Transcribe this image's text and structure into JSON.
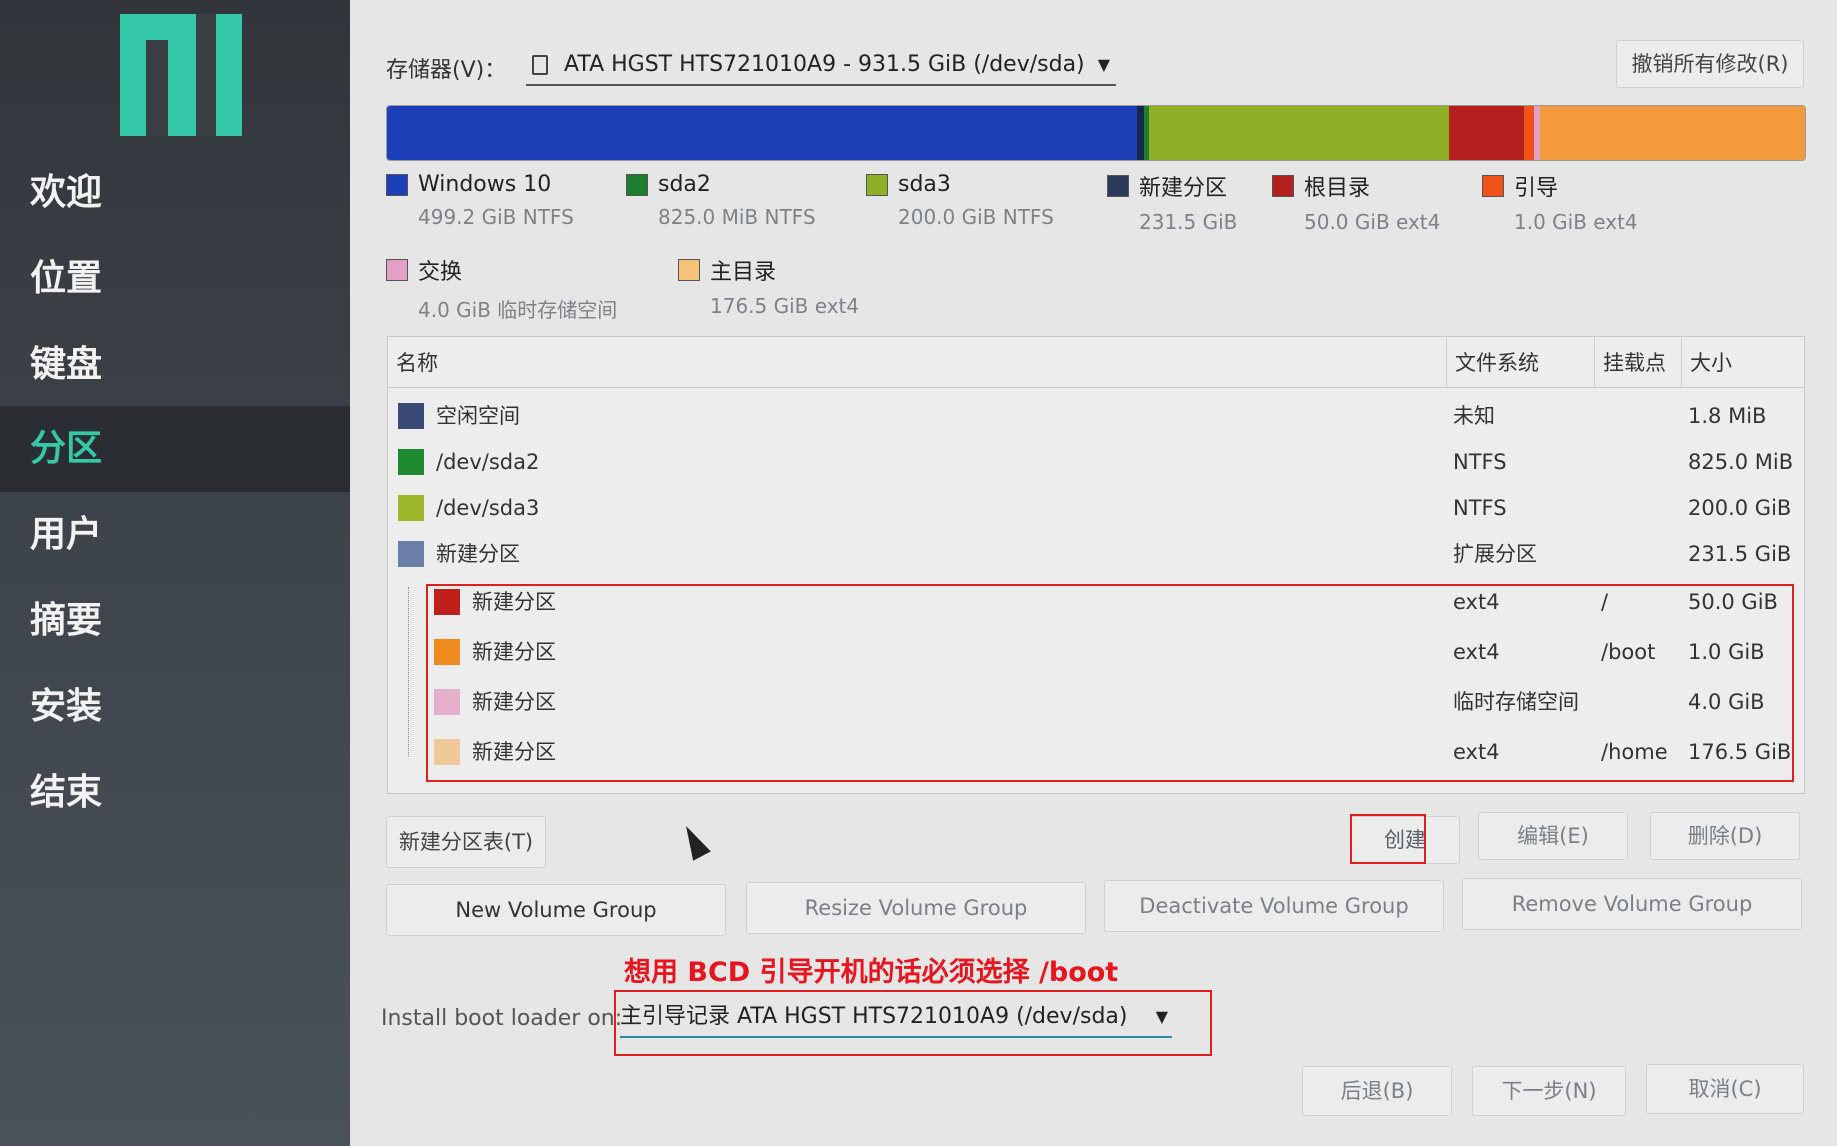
{
  "sidebar": {
    "items": [
      {
        "label": "欢迎",
        "active": false
      },
      {
        "label": "位置",
        "active": false
      },
      {
        "label": "键盘",
        "active": false
      },
      {
        "label": "分区",
        "active": true
      },
      {
        "label": "用户",
        "active": false
      },
      {
        "label": "摘要",
        "active": false
      },
      {
        "label": "安装",
        "active": false
      },
      {
        "label": "结束",
        "active": false
      }
    ]
  },
  "storage": {
    "label": "存储器(V)：",
    "selected": "ATA HGST HTS721010A9 - 931.5 GiB (/dev/sda)"
  },
  "buttons": {
    "revert_all": "撤销所有修改(R)",
    "new_partition_table": "新建分区表(T)",
    "create": "创建",
    "edit": "编辑(E)",
    "delete": "删除(D)",
    "new_vg": "New Volume Group",
    "resize_vg": "Resize Volume Group",
    "deactivate_vg": "Deactivate Volume Group",
    "remove_vg": "Remove Volume Group",
    "back": "后退(B)",
    "next": "下一步(N)",
    "cancel": "取消(C)"
  },
  "disk_bar": {
    "segments": [
      {
        "color": "#1d3fb8",
        "fraction": 0.5358
      },
      {
        "color": "#15284a",
        "fraction": 0.0045
      },
      {
        "color": "#1d7d2e",
        "fraction": 0.0035
      },
      {
        "color": "#8fb026",
        "fraction": 0.2147
      },
      {
        "color": "#b4201d",
        "fraction": 0.0537
      },
      {
        "color": "#f0521a",
        "fraction": 0.0065
      },
      {
        "color": "#e3a0c4",
        "fraction": 0.0043
      },
      {
        "color": "#f39a3c",
        "fraction": 0.1895
      }
    ]
  },
  "legend": [
    {
      "name": "Windows 10",
      "info": "499.2 GiB  NTFS",
      "color": "#1d3fb8"
    },
    {
      "name": "sda2",
      "info": "825.0 MiB  NTFS",
      "color": "#1d7d2e"
    },
    {
      "name": "sda3",
      "info": "200.0 GiB  NTFS",
      "color": "#8fb026"
    },
    {
      "name": "新建分区",
      "info": "231.5 GiB",
      "color": "#2e3a5c"
    },
    {
      "name": "根目录",
      "info": "50.0 GiB  ext4",
      "color": "#b4201d"
    },
    {
      "name": "引导",
      "info": "1.0 GiB  ext4",
      "color": "#f0521a"
    },
    {
      "name": "交换",
      "info": "4.0 GiB  临时存储空间",
      "color": "#e3a0c4"
    },
    {
      "name": "主目录",
      "info": "176.5 GiB  ext4",
      "color": "#f5c277"
    }
  ],
  "table": {
    "columns": [
      "名称",
      "文件系统",
      "挂载点",
      "大小"
    ],
    "rows": [
      {
        "name": "空闲空间",
        "fs": "未知",
        "mount": "",
        "size": "1.8 MiB",
        "color": "#3a4a78",
        "indent": false
      },
      {
        "name": "/dev/sda2",
        "fs": "NTFS",
        "mount": "",
        "size": "825.0 MiB",
        "color": "#1d8a2e",
        "indent": false
      },
      {
        "name": "/dev/sda3",
        "fs": "NTFS",
        "mount": "",
        "size": "200.0 GiB",
        "color": "#9cb82a",
        "indent": false
      },
      {
        "name": "新建分区",
        "fs": "扩展分区",
        "mount": "",
        "size": "231.5 GiB",
        "color": "#6a7fa8",
        "indent": false
      },
      {
        "name": "新建分区",
        "fs": "ext4",
        "mount": "/",
        "size": "50.0 GiB",
        "color": "#c0201c",
        "indent": true
      },
      {
        "name": "新建分区",
        "fs": "ext4",
        "mount": "/boot",
        "size": "1.0 GiB",
        "color": "#ee8a1e",
        "indent": true
      },
      {
        "name": "新建分区",
        "fs": "临时存储空间",
        "mount": "",
        "size": "4.0 GiB",
        "color": "#e6b0cc",
        "indent": true
      },
      {
        "name": "新建分区",
        "fs": "ext4",
        "mount": "/home",
        "size": "176.5 GiB",
        "color": "#f0c89a",
        "indent": true
      }
    ]
  },
  "bootloader": {
    "label": "Install boot loader on:",
    "selected": "主引导记录 ATA HGST HTS721010A9 (/dev/sda)"
  },
  "annotation": "想用 BCD 引导开机的话必须选择 /boot",
  "colors": {
    "accent": "#35c8a8",
    "highlight": "#e02020"
  }
}
